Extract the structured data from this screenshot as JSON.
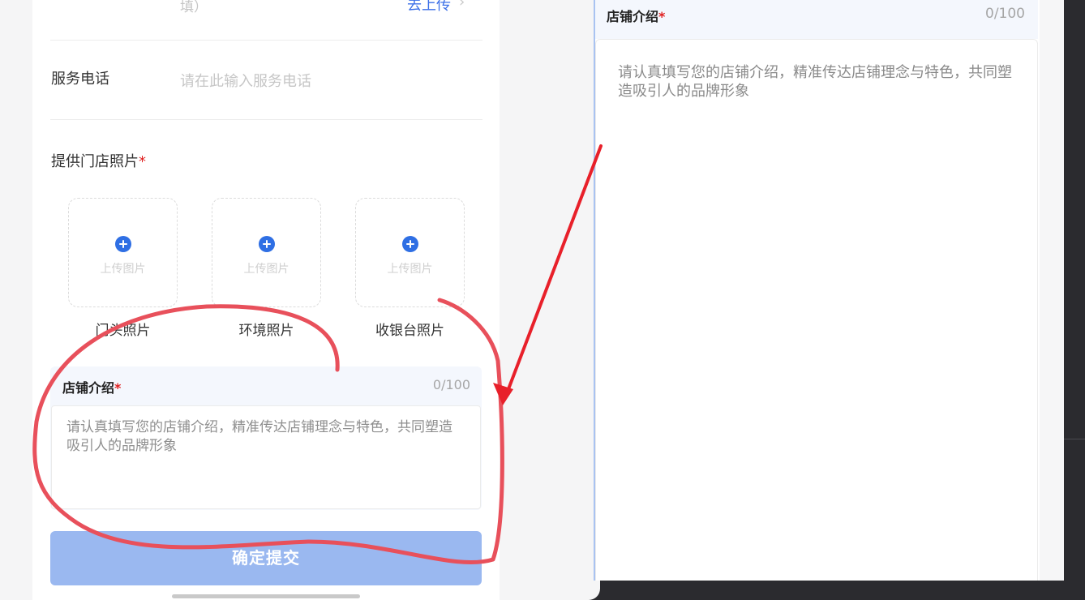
{
  "form": {
    "cut_row_text": "填）",
    "cut_row_link": "去上传",
    "service_phone": {
      "label": "服务电话",
      "placeholder": "请在此输入服务电话"
    },
    "photos": {
      "title": "提供门店照片",
      "required_mark": "*",
      "upload_text": "上传图片",
      "items": [
        {
          "label": "门头照片"
        },
        {
          "label": "环境照片"
        },
        {
          "label": "收银台照片"
        }
      ]
    },
    "intro": {
      "title": "店铺介绍",
      "required_mark": "*",
      "counter": "0/100",
      "placeholder": "请认真填写您的店铺介绍，精准传达店铺理念与特色，共同塑造吸引人的品牌形象"
    },
    "submit_label": "确定提交"
  },
  "zoom": {
    "title": "店铺介绍",
    "required_mark": "*",
    "counter": "0/100",
    "placeholder": "请认真填写您的店铺介绍，精准传达店铺理念与特色，共同塑造吸引人的品牌形象"
  },
  "colors": {
    "accent": "#2f6fe4",
    "required": "#e02020",
    "submit_disabled": "#9ab8f0",
    "annotation_circle": "#e8505b",
    "annotation_arrow": "#e8202a"
  },
  "icons": {
    "upload": "plus-circle-icon",
    "chevron": "chevron-right-icon"
  }
}
